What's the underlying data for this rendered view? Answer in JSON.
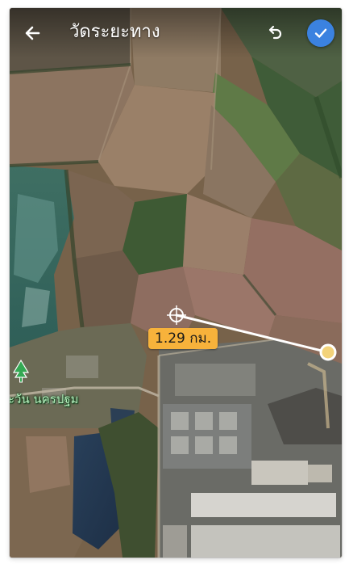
{
  "toolbar": {
    "title": "วัดระยะทาง",
    "back_icon": "arrow-left-icon",
    "undo_icon": "undo-icon",
    "confirm_icon": "check-icon",
    "confirm_color": "#3b82e0"
  },
  "measurement": {
    "distance_label": "1.29 กม.",
    "badge_color": "#f7b23b",
    "line_color": "#ffffff",
    "endpoint_color": "#f3d37a"
  },
  "map": {
    "type": "satellite",
    "place_label": "ะวัน นครปฐม",
    "place_icon": "tree-pin-icon",
    "place_color": "#34a853"
  }
}
